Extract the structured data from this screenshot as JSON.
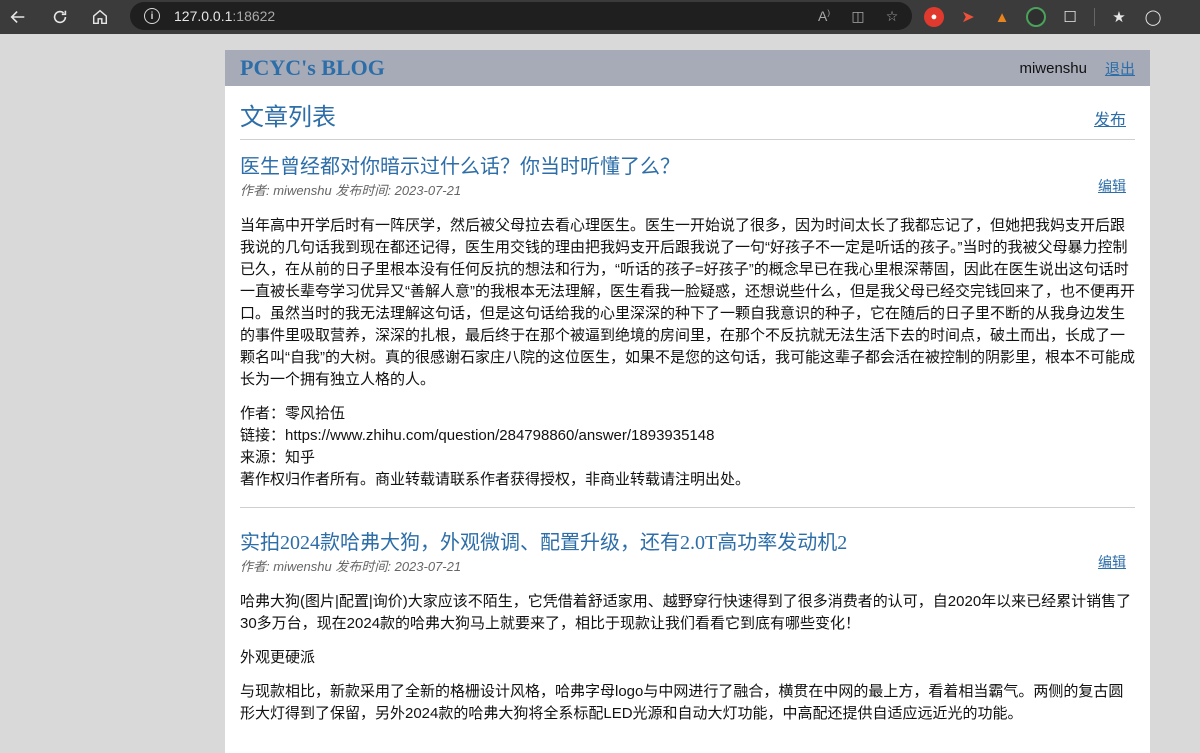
{
  "browser": {
    "url_host": "127.0.0.1",
    "url_port": ":18622"
  },
  "header": {
    "blog_title": "PCYC's BLOG",
    "username": "miwenshu",
    "logout_label": "退出"
  },
  "list": {
    "title": "文章列表",
    "publish_label": "发布"
  },
  "articles": [
    {
      "title": "医生曾经都对你暗示过什么话？你当时听懂了么？",
      "meta": "作者: miwenshu 发布时间: 2023-07-21",
      "edit_label": "编辑",
      "paragraphs": [
        "当年高中开学后时有一阵厌学，然后被父母拉去看心理医生。医生一开始说了很多，因为时间太长了我都忘记了，但她把我妈支开后跟我说的几句话我到现在都还记得，医生用交钱的理由把我妈支开后跟我说了一句“好孩子不一定是听话的孩子。”当时的我被父母暴力控制已久，在从前的日子里根本没有任何反抗的想法和行为，“听话的孩子=好孩子”的概念早已在我心里根深蒂固，因此在医生说出这句话时一直被长辈夸学习优异又“善解人意”的我根本无法理解，医生看我一脸疑惑，还想说些什么，但是我父母已经交完钱回来了，也不便再开口。虽然当时的我无法理解这句话，但是这句话给我的心里深深的种下了一颗自我意识的种子，它在随后的日子里不断的从我身边发生的事件里吸取营养，深深的扎根，最后终于在那个被逼到绝境的房间里，在那个不反抗就无法生活下去的时间点，破土而出，长成了一颗名叫“自我”的大树。真的很感谢石家庄八院的这位医生，如果不是您的这句话，我可能这辈子都会活在被控制的阴影里，根本不可能成长为一个拥有独立人格的人。"
      ],
      "info_lines": [
        "作者：零风拾伍",
        "链接：https://www.zhihu.com/question/284798860/answer/1893935148",
        "来源：知乎",
        "著作权归作者所有。商业转载请联系作者获得授权，非商业转载请注明出处。"
      ]
    },
    {
      "title": "实拍2024款哈弗大狗，外观微调、配置升级，还有2.0T高功率发动机2",
      "meta": "作者: miwenshu 发布时间: 2023-07-21",
      "edit_label": "编辑",
      "paragraphs": [
        "哈弗大狗(图片|配置|询价)大家应该不陌生，它凭借着舒适家用、越野穿行快速得到了很多消费者的认可，自2020年以来已经累计销售了30多万台，现在2024款的哈弗大狗马上就要来了，相比于现款让我们看看它到底有哪些变化！",
        "外观更硬派",
        "与现款相比，新款采用了全新的格栅设计风格，哈弗字母logo与中网进行了融合，横贯在中网的最上方，看着相当霸气。两侧的复古圆形大灯得到了保留，另外2024款的哈弗大狗将全系标配LED光源和自动大灯功能，中高配还提供自适应远近光的功能。"
      ]
    }
  ]
}
